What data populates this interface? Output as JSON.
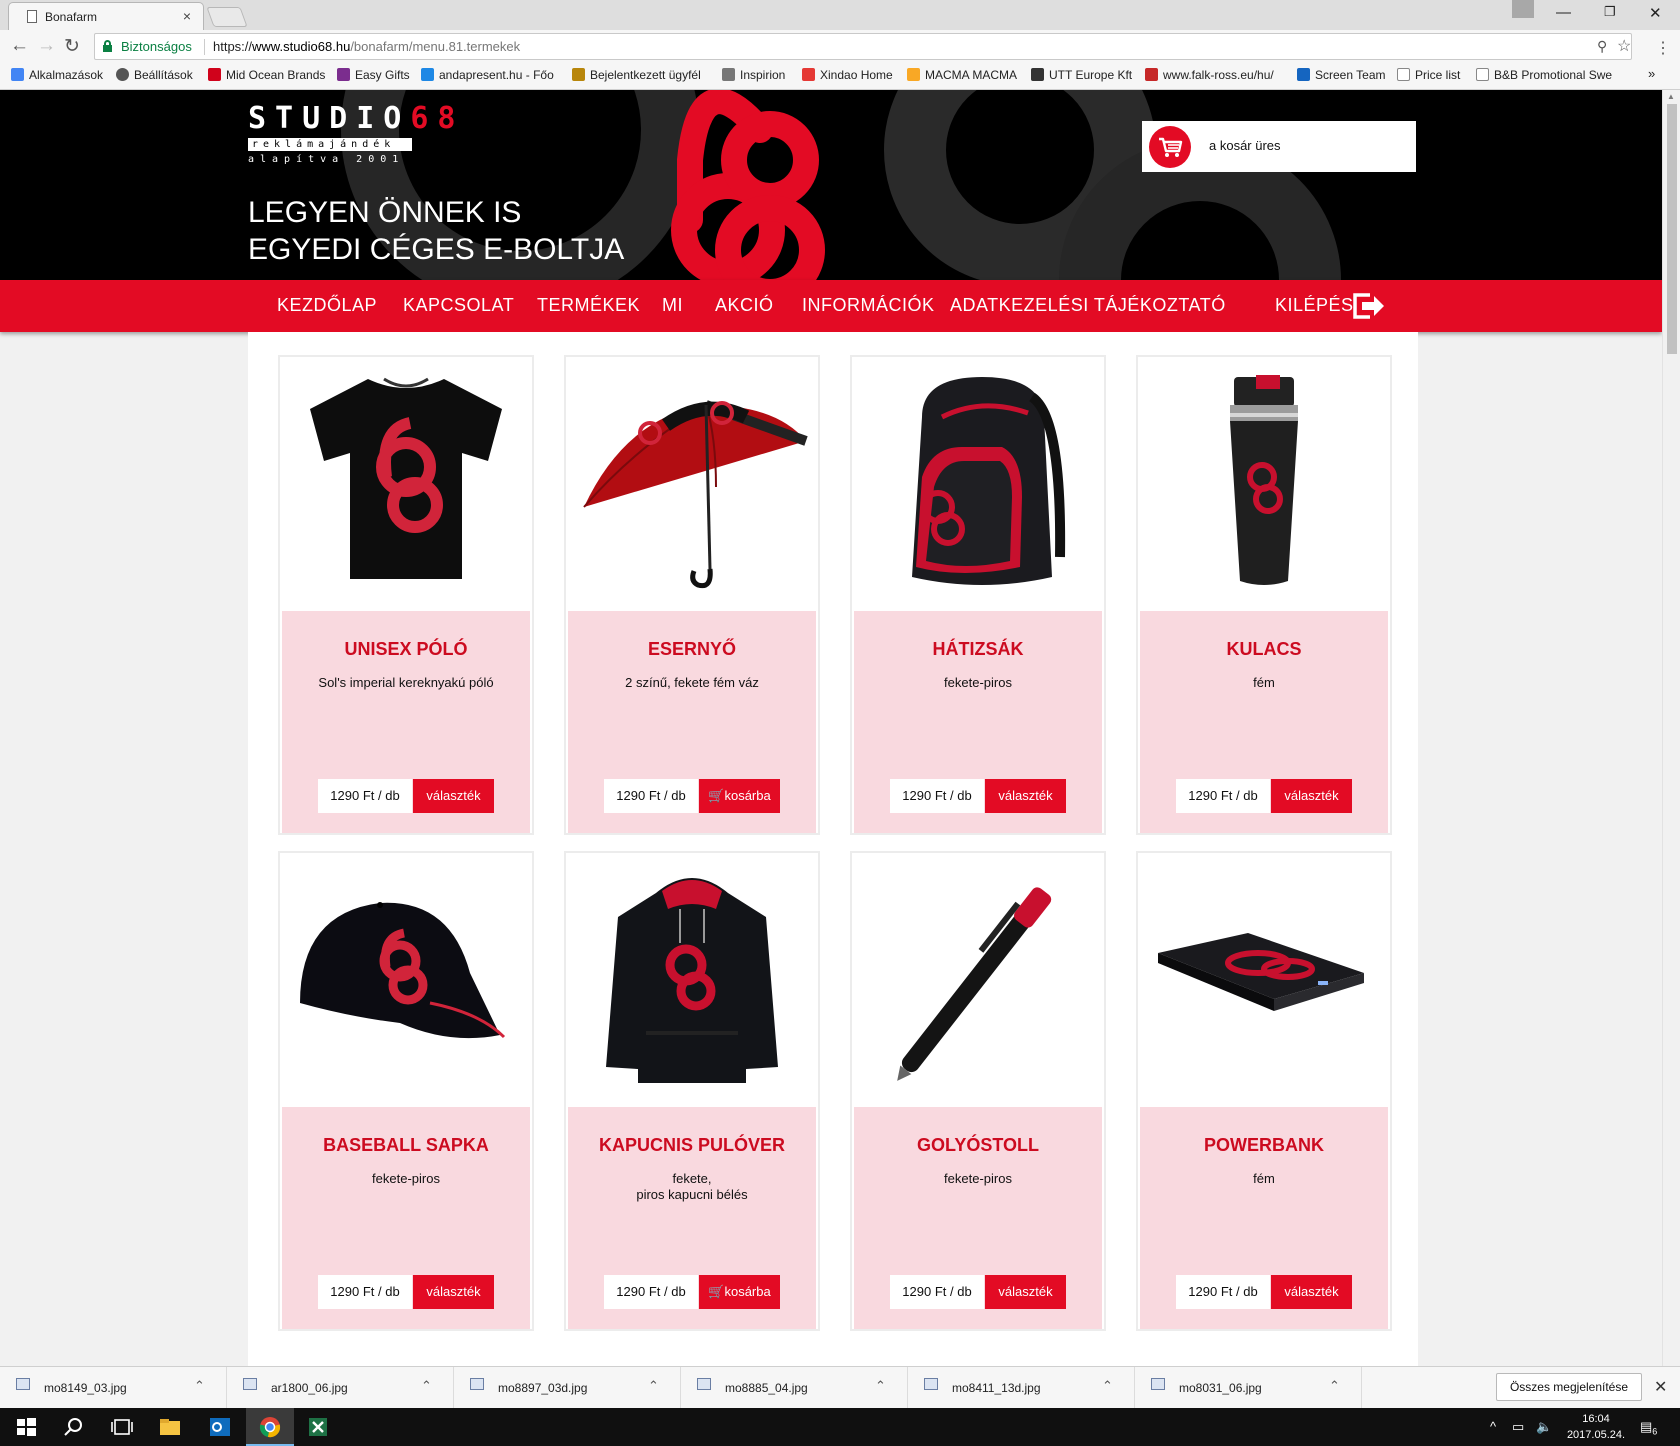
{
  "browser": {
    "tab_title": "Bonafarm",
    "tab_close": "×",
    "back": "←",
    "forward": "→",
    "reload": "↻",
    "secure_label": "Biztonságos",
    "url_scheme": "https://",
    "url_host": "www.studio68.hu",
    "url_path": "/bonafarm/menu.81.termekek",
    "star": "☆",
    "key": "⚲",
    "menu": "⋮",
    "minimize": "—",
    "restore": "❐",
    "close": "✕",
    "bookmarks_more": "»"
  },
  "bookmarks": [
    {
      "label": "Alkalmazások",
      "color": "#4285f4"
    },
    {
      "label": "Beállítások",
      "color": "#555555"
    },
    {
      "label": "Mid Ocean Brands",
      "color": "#d0021b"
    },
    {
      "label": "Easy Gifts",
      "color": "#7b2d8e"
    },
    {
      "label": "andapresent.hu - Főo",
      "color": "#1e88e5"
    },
    {
      "label": "Bejelentkezett ügyfél",
      "color": "#b8860b"
    },
    {
      "label": "Inspirion",
      "color": "#777777"
    },
    {
      "label": "Xindao Home",
      "color": "#e53935"
    },
    {
      "label": "MACMA MACMA",
      "color": "#f9a825"
    },
    {
      "label": "UTT Europe Kft",
      "color": "#333333"
    },
    {
      "label": "www.falk-ross.eu/hu/",
      "color": "#c62828"
    },
    {
      "label": "Screen Team",
      "color": "#1565c0"
    },
    {
      "label": "Price list",
      "color": "#9e9e9e"
    },
    {
      "label": "B&B Promotional Swe",
      "color": "#9e9e9e"
    }
  ],
  "site": {
    "logo_word_white": "STUDIO",
    "logo_word_red": "68",
    "logo_line1": "reklámajándék",
    "logo_line2": "alapítva 2001",
    "slogan_line1": "LEGYEN ÖNNEK IS",
    "slogan_line2": "EGYEDI CÉGES E-BOLTJA",
    "cart_text": "a kosár üres",
    "brand_color": "#e30b24",
    "card_bg": "#f9d9df"
  },
  "nav": [
    {
      "label": "KEZDŐLAP"
    },
    {
      "label": "KAPCSOLAT"
    },
    {
      "label": "TERMÉKEK"
    },
    {
      "label": "MI"
    },
    {
      "label": "AKCIÓ"
    },
    {
      "label": "INFORMÁCIÓK"
    },
    {
      "label": "ADATKEZELÉSI TÁJÉKOZTATÓ"
    },
    {
      "label": "KILÉPÉS"
    }
  ],
  "products": [
    {
      "name": "UNISEX PÓLÓ",
      "desc": "Sol's imperial kereknyakú póló",
      "price": "1290 Ft / db",
      "button": "választék",
      "icon": "tshirt-icon"
    },
    {
      "name": "ESERNYŐ",
      "desc": "2 színű, fekete fém váz",
      "price": "1290 Ft / db",
      "button": "kosárba",
      "icon": "umbrella-icon"
    },
    {
      "name": "HÁTIZSÁK",
      "desc": "fekete-piros",
      "price": "1290 Ft / db",
      "button": "választék",
      "icon": "backpack-icon"
    },
    {
      "name": "KULACS",
      "desc": "fém",
      "price": "1290 Ft / db",
      "button": "választék",
      "icon": "bottle-icon"
    },
    {
      "name": "BASEBALL SAPKA",
      "desc": "fekete-piros",
      "price": "1290 Ft / db",
      "button": "választék",
      "icon": "cap-icon"
    },
    {
      "name": "KAPUCNIS PULÓVER",
      "desc": "fekete,\npiros kapucni bélés",
      "price": "1290 Ft / db",
      "button": "kosárba",
      "icon": "hoodie-icon"
    },
    {
      "name": "GOLYÓSTOLL",
      "desc": "fekete-piros",
      "price": "1290 Ft / db",
      "button": "választék",
      "icon": "pen-icon"
    },
    {
      "name": "POWERBANK",
      "desc": "fém",
      "price": "1290 Ft / db",
      "button": "választék",
      "icon": "powerbank-icon"
    }
  ],
  "downloads": [
    {
      "file": "mo8149_03.jpg"
    },
    {
      "file": "ar1800_06.jpg"
    },
    {
      "file": "mo8897_03d.jpg"
    },
    {
      "file": "mo8885_04.jpg"
    },
    {
      "file": "mo8411_13d.jpg"
    },
    {
      "file": "mo8031_06.jpg"
    }
  ],
  "downloads_show_all": "Összes megjelenítése",
  "downloads_close": "✕",
  "taskbar": {
    "time": "16:04",
    "date": "2017.05.24.",
    "notifications": "6"
  }
}
